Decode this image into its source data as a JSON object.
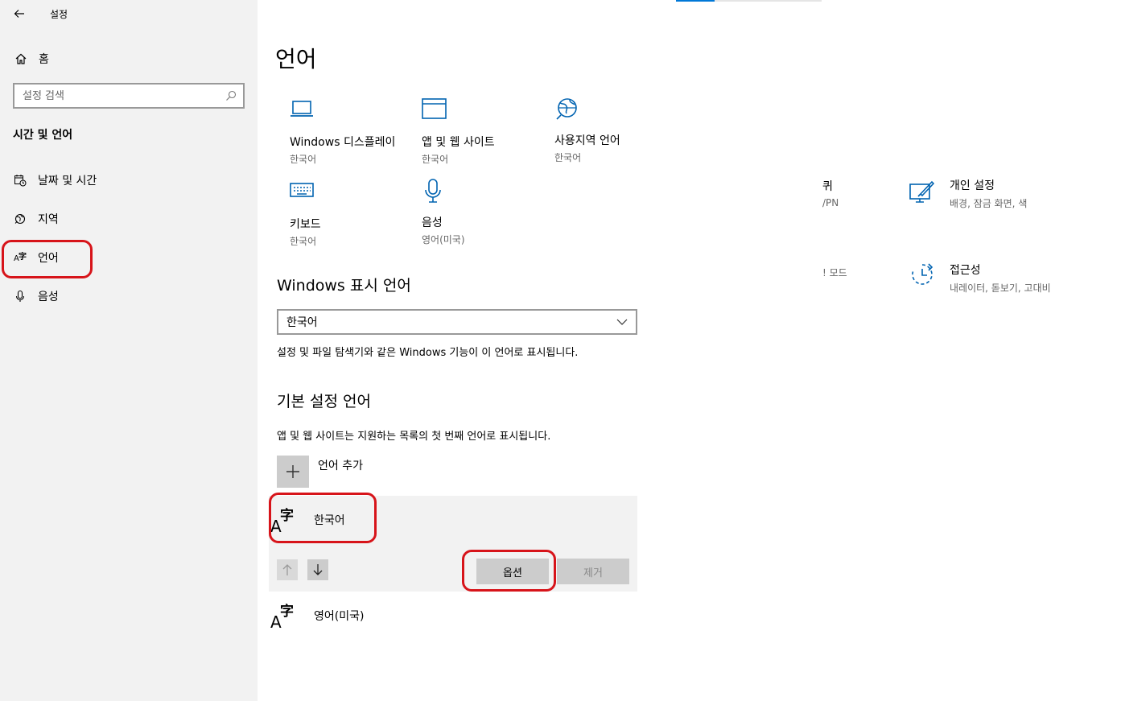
{
  "window": {
    "title": "설정"
  },
  "sidebar": {
    "home_label": "홈",
    "search_placeholder": "설정 검색",
    "section_title": "시간 및 언어",
    "items": [
      {
        "label": "날짜 및 시간",
        "icon": "calendar-clock-icon"
      },
      {
        "label": "지역",
        "icon": "globe-region-icon"
      },
      {
        "label": "언어",
        "icon": "language-icon",
        "selected": true
      },
      {
        "label": "음성",
        "icon": "microphone-icon"
      }
    ]
  },
  "main": {
    "title": "언어",
    "tiles": [
      {
        "label": "Windows 디스플레이",
        "sub": "한국어",
        "icon": "laptop-icon"
      },
      {
        "label": "앱 및 웹 사이트",
        "sub": "한국어",
        "icon": "window-icon"
      },
      {
        "label": "사용지역 언어",
        "sub": "한국어",
        "icon": "globe-icon"
      },
      {
        "label": "키보드",
        "sub": "한국어",
        "icon": "keyboard-icon"
      },
      {
        "label": "음성",
        "sub": "영어(미국)",
        "icon": "microphone-icon"
      }
    ],
    "background_peek": [
      {
        "label": "퀴",
        "sub": "/PN"
      },
      {
        "label": "",
        "sub": "! 모드"
      },
      {
        "label": "개인 설정",
        "sub": "배경, 잠금 화면, 색",
        "icon": "personalization-icon"
      },
      {
        "label": "접근성",
        "sub": "내레이터, 돋보기, 고대비",
        "icon": "accessibility-icon"
      }
    ],
    "display_language": {
      "heading": "Windows 표시 언어",
      "selected": "한국어",
      "description": "설정 및 파일 탐색기와 같은 Windows 기능이 이 언어로 표시됩니다."
    },
    "preferred": {
      "heading": "기본 설정 언어",
      "description": "앱 및 웹 사이트는 지원하는 목록의 첫 번째 언어로 표시됩니다.",
      "add_label": "언어 추가",
      "languages": [
        {
          "name": "한국어",
          "selected": true
        },
        {
          "name": "영어(미국)"
        }
      ],
      "options_label": "옵션",
      "remove_label": "제거",
      "glyph_latin": "A",
      "glyph_cjk": "字"
    }
  },
  "colors": {
    "accent": "#0078d7",
    "highlight": "#d7141a"
  }
}
